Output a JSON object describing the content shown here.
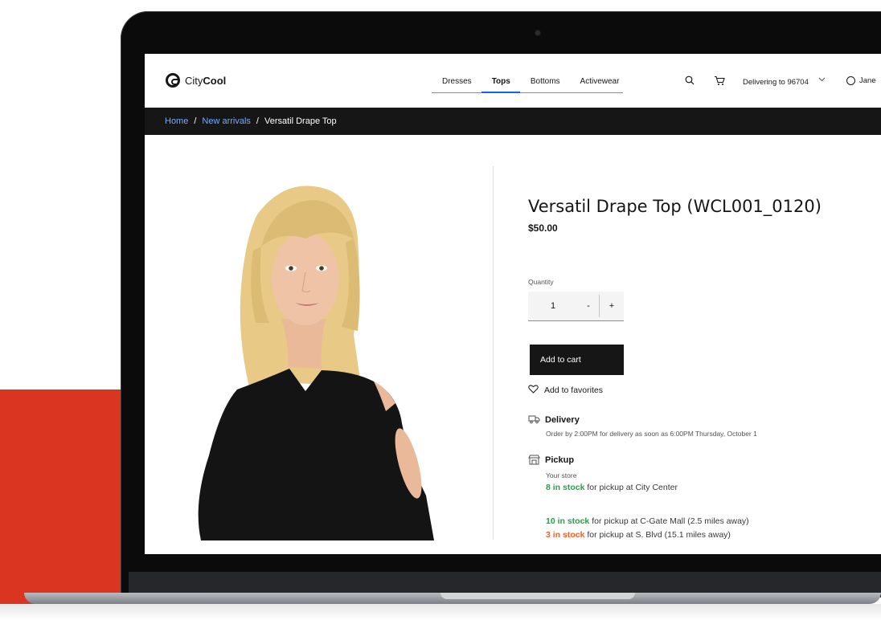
{
  "header": {
    "brand_light": "City",
    "brand_bold": "Cool",
    "tabs": [
      {
        "label": "Dresses"
      },
      {
        "label": "Tops",
        "active": true
      },
      {
        "label": "Bottoms"
      },
      {
        "label": "Activewear"
      }
    ],
    "delivery_label": "Delivering to 96704",
    "user_name": "Jane",
    "icons": {
      "search": "search-icon",
      "cart": "cart-icon",
      "chevron": "chevron-down-icon",
      "user": "user-avatar-icon"
    }
  },
  "breadcrumb": {
    "items": [
      "Home",
      "New arrivals"
    ],
    "current": "Versatil Drape Top"
  },
  "product": {
    "title": "Versatil Drape Top (WCL001_0120)",
    "price": "$50.00",
    "quantity_label": "Quantity",
    "quantity_value": "1",
    "minus": "-",
    "plus": "+",
    "add_to_cart": "Add to cart",
    "add_to_favorites": "Add to favorites"
  },
  "delivery": {
    "title": "Delivery",
    "note": "Order by 2:00PM for delivery as soon as 6:00PM Thursday, October 1"
  },
  "pickup": {
    "title": "Pickup",
    "your_store": "Your store",
    "stores": [
      {
        "count": "8 in stock",
        "text": " for pickup at City Center",
        "color": "green"
      },
      {
        "count": "10 in stock",
        "text": " for pickup at C-Gate Mall (2.5 miles away)",
        "color": "green"
      },
      {
        "count": "3 in stock",
        "text": " for pickup at S. Blvd (15.1 miles away)",
        "color": "orange"
      }
    ]
  },
  "colors": {
    "accent": "#0f62fe",
    "brand_red": "#d93520",
    "in_stock": "#24a148",
    "low_stock": "#ff5a1f"
  }
}
